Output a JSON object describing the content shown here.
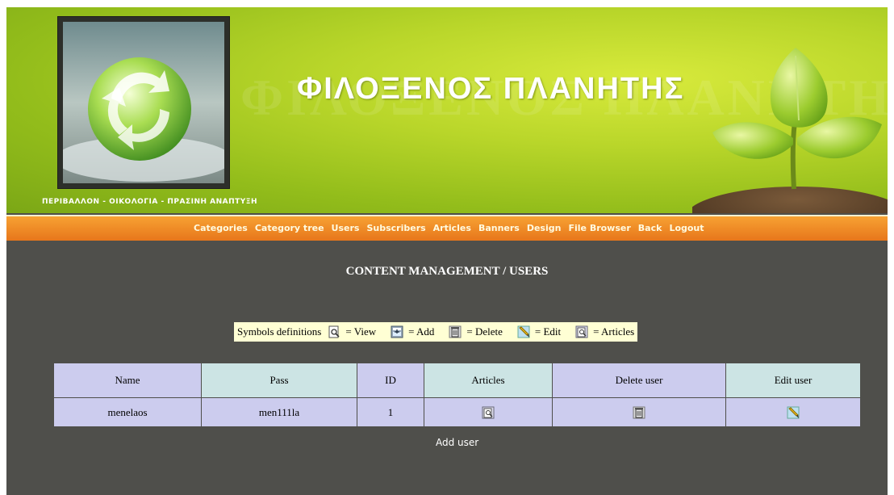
{
  "header": {
    "site_title": "ΦΙΛΟΞΕΝΟΣ ΠΛΑΝΗΤΗΣ",
    "tagline": "ΠΕΡΙΒΑΛΛΟΝ - ΟΙΚΟΛΟΓΙΑ - ΠΡΑΣΙΝΗ ΑΝΑΠΤΥΞΗ"
  },
  "nav": {
    "items": [
      {
        "label": "Categories"
      },
      {
        "label": "Category tree"
      },
      {
        "label": "Users"
      },
      {
        "label": "Subscribers"
      },
      {
        "label": "Articles"
      },
      {
        "label": "Banners"
      },
      {
        "label": "Design"
      },
      {
        "label": "File Browser"
      },
      {
        "label": "Back"
      },
      {
        "label": "Logout"
      }
    ]
  },
  "main": {
    "heading": "CONTENT MANAGEMENT / USERS",
    "legend": {
      "prefix": "Symbols definitions",
      "view": "= View",
      "add": "= Add",
      "delete": "= Delete",
      "edit": "= Edit",
      "articles": "= Articles"
    },
    "table": {
      "headers": [
        "Name",
        "Pass",
        "ID",
        "Articles",
        "Delete user",
        "Edit user"
      ],
      "rows": [
        {
          "name": "menelaos",
          "pass": "men111la",
          "id": "1"
        }
      ]
    },
    "add_user_label": "Add user"
  },
  "colors": {
    "background": "#4f4f4b",
    "nav_orange": "#f08c27",
    "header_purple": "#ccccee",
    "header_teal": "#cce4e4",
    "legend_bg": "#ffffd4"
  }
}
